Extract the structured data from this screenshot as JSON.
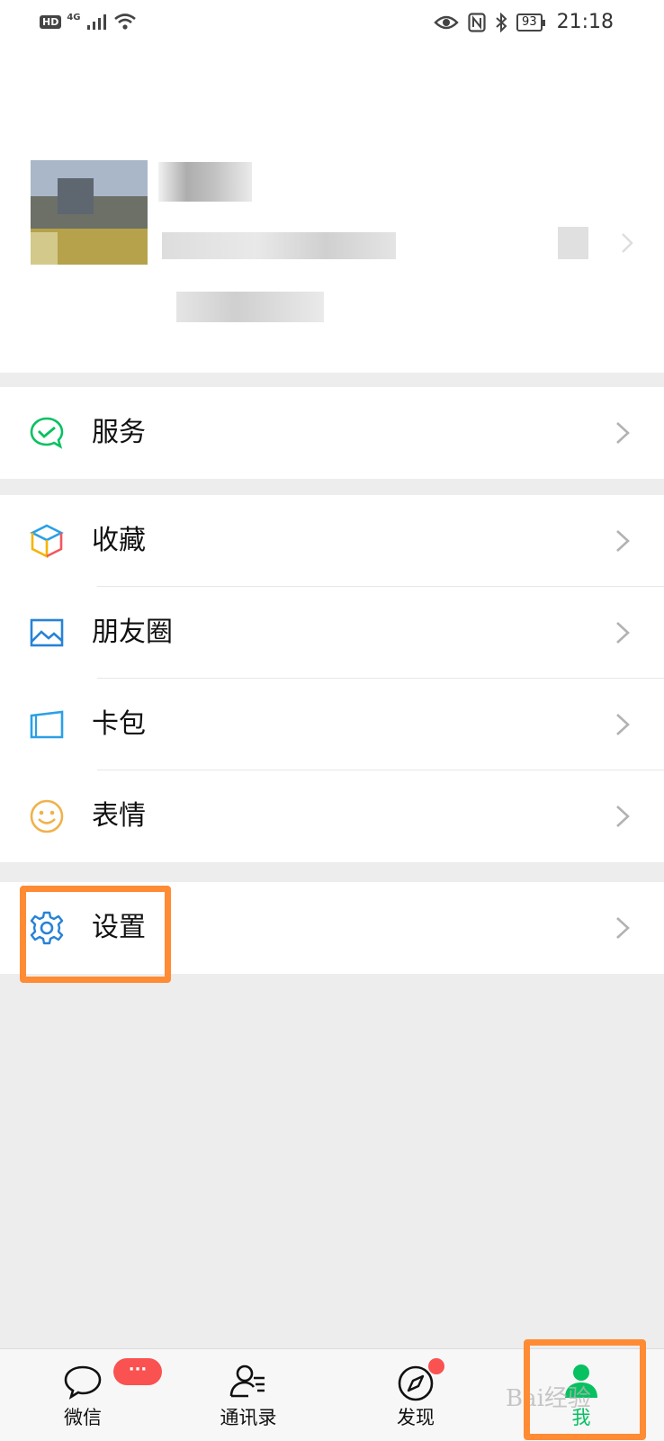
{
  "status_bar": {
    "hd": "HD",
    "network": "4G",
    "battery": "93",
    "time": "21:18"
  },
  "menu": {
    "services": "服务",
    "favorites": "收藏",
    "moments": "朋友圈",
    "cards": "卡包",
    "stickers": "表情",
    "settings": "设置"
  },
  "tabs": {
    "chats": "微信",
    "contacts": "通讯录",
    "discover": "发现",
    "me": "我",
    "chats_badge": "···"
  },
  "watermark": "Bai经验",
  "colors": {
    "accent_green": "#07c160",
    "highlight_orange": "#ff8b34",
    "badge_red": "#fa5151"
  }
}
